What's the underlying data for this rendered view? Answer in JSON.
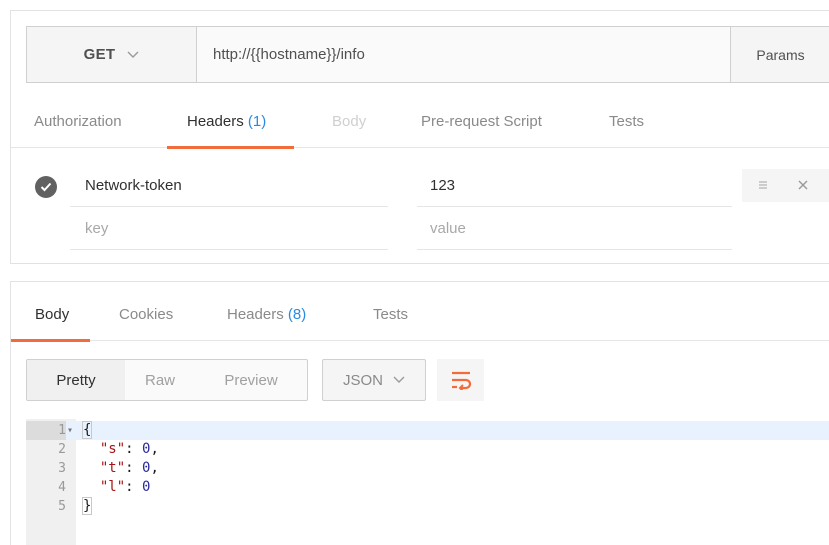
{
  "request": {
    "method": "GET",
    "url": "http://{{hostname}}/info",
    "params_label": "Params",
    "tabs": [
      {
        "label": "Authorization",
        "count": ""
      },
      {
        "label": "Headers",
        "count": "(1)"
      },
      {
        "label": "Body",
        "count": ""
      },
      {
        "label": "Pre-request Script",
        "count": ""
      },
      {
        "label": "Tests",
        "count": ""
      }
    ],
    "active_tab": "Headers",
    "headers": [
      {
        "key": "Network-token",
        "value": "123",
        "enabled": true
      }
    ],
    "key_placeholder": "key",
    "value_placeholder": "value"
  },
  "response": {
    "tabs": [
      {
        "label": "Body",
        "count": ""
      },
      {
        "label": "Cookies",
        "count": ""
      },
      {
        "label": "Headers",
        "count": "(8)"
      },
      {
        "label": "Tests",
        "count": ""
      }
    ],
    "active_tab": "Body",
    "view_modes": [
      "Pretty",
      "Raw",
      "Preview"
    ],
    "active_view": "Pretty",
    "format": "JSON",
    "code": {
      "line_numbers": [
        "1",
        "2",
        "3",
        "4",
        "5"
      ],
      "open_brace": "{",
      "close_brace": "}",
      "entries": [
        {
          "key": "\"s\"",
          "value": "0",
          "sep": ","
        },
        {
          "key": "\"t\"",
          "value": "0",
          "sep": ","
        },
        {
          "key": "\"l\"",
          "value": "0",
          "sep": ""
        }
      ]
    }
  },
  "colors": {
    "accent": "#f26b3a",
    "count": "#2a8ae2",
    "check": "#616161",
    "active_line": "#e8f2ff"
  },
  "icons": [
    "chevron-down-icon",
    "check-icon",
    "menu-icon",
    "close-icon",
    "wrap-lines-icon"
  ]
}
